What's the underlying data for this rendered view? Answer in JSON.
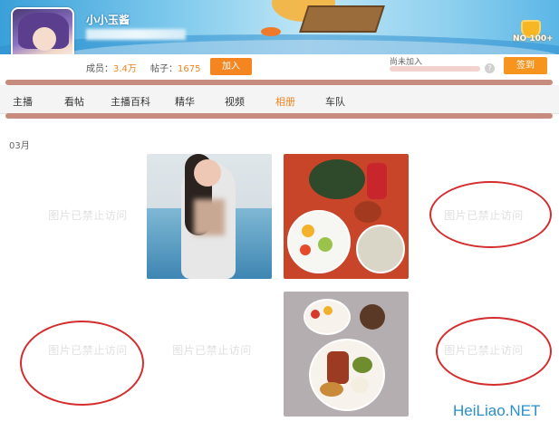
{
  "header": {
    "room_name": "小小玉酱",
    "rank": "NO 100+",
    "members_label": "成员：",
    "members_value": "3.4万",
    "posts_label": "帖子：",
    "posts_value": "1675",
    "join_label": "加入",
    "status_text": "尚未加入",
    "progress": 0,
    "help_icon_text": "?",
    "signin_label": "签到"
  },
  "nav": {
    "items": [
      {
        "label": "主播"
      },
      {
        "label": "看帖"
      },
      {
        "label": "主播百科"
      },
      {
        "label": "精华"
      },
      {
        "label": "视频"
      },
      {
        "label": "相册",
        "active": true
      },
      {
        "label": "车队"
      }
    ]
  },
  "album": {
    "month": "03月",
    "forbidden_text": "图片已禁止访问"
  },
  "watermark": "HeiLiao.NET",
  "colors": {
    "accent": "#f0841f",
    "ring": "#d42d2d",
    "divider": "#c88c7e"
  }
}
